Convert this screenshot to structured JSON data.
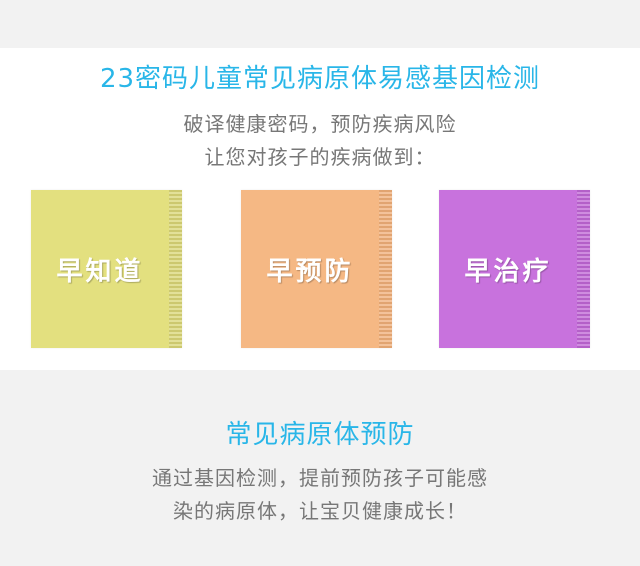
{
  "header": {
    "title": "23密码儿童常见病原体易感基因检测",
    "subtitle_line1": "破译健康密码，预防疾病风险",
    "subtitle_line2": "让您对孩子的疾病做到："
  },
  "cards": [
    {
      "label": "早知道",
      "color": "#e3e07f"
    },
    {
      "label": "早预防",
      "color": "#f5b884"
    },
    {
      "label": "早治疗",
      "color": "#c872dd"
    }
  ],
  "section2": {
    "title": "常见病原体预防",
    "desc_line1": "通过基因检测，提前预防孩子可能感",
    "desc_line2": "染的病原体，让宝贝健康成长！"
  },
  "colors": {
    "accent": "#29b6e8",
    "text_gray": "#777777",
    "background": "#f2f2f2"
  }
}
